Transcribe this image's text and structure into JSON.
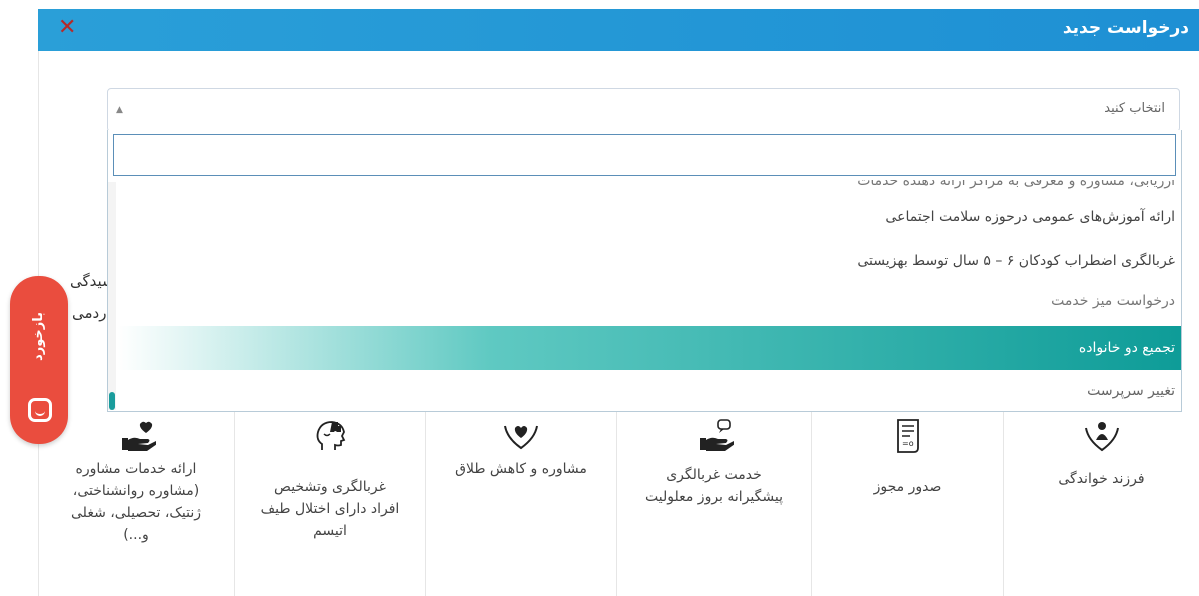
{
  "modal": {
    "title": "درخواست جدید",
    "close_glyph": "✕"
  },
  "background_fragments": [
    "سیدگی",
    "ردمی"
  ],
  "select": {
    "value": "انتخاب کنید",
    "arrow_glyph": "▲",
    "search_value": ""
  },
  "options": {
    "cut": "ارزیابی، مشاوره و معرفی به مراکز ارائه دهنده خدمات",
    "items": [
      "ارائه آموزش‌های عمومی درحوزه سلامت اجتماعی",
      "غربالگری اضطراب کودکان ۶ – ۵ سال توسط بهزیستی",
      "درخواست میز خدمت",
      "تجمیع دو خانواده",
      "تغییر سرپرست"
    ],
    "highlighted_index": 3
  },
  "feedback": {
    "label": "بازخورد"
  },
  "tiles": [
    {
      "label": "ارائه خدمات مشاوره\n(مشاوره روانشناختی،\nژنتیک، تحصیلی، شغلی\nو...)",
      "icon": "hand-heart-icon"
    },
    {
      "label": "غربالگری وتشخیص\nافراد دارای اختلال طیف\nاتیسم",
      "icon": "head-puzzle-icon"
    },
    {
      "label": "مشاوره و کاهش طلاق",
      "icon": "hands-heart-icon"
    },
    {
      "label": "خدمت غربالگری\nپیشگیرانه بروز معلولیت",
      "icon": "hand-chat-icon"
    },
    {
      "label": "صدور مجوز",
      "icon": "document-icon"
    },
    {
      "label": "فرزند خواندگی",
      "icon": "child-hands-icon"
    }
  ],
  "colors": {
    "header": "#2a9fd8",
    "highlight": "#0e9c98",
    "feedback": "#ea4d3e",
    "close": "#b52a2a"
  }
}
